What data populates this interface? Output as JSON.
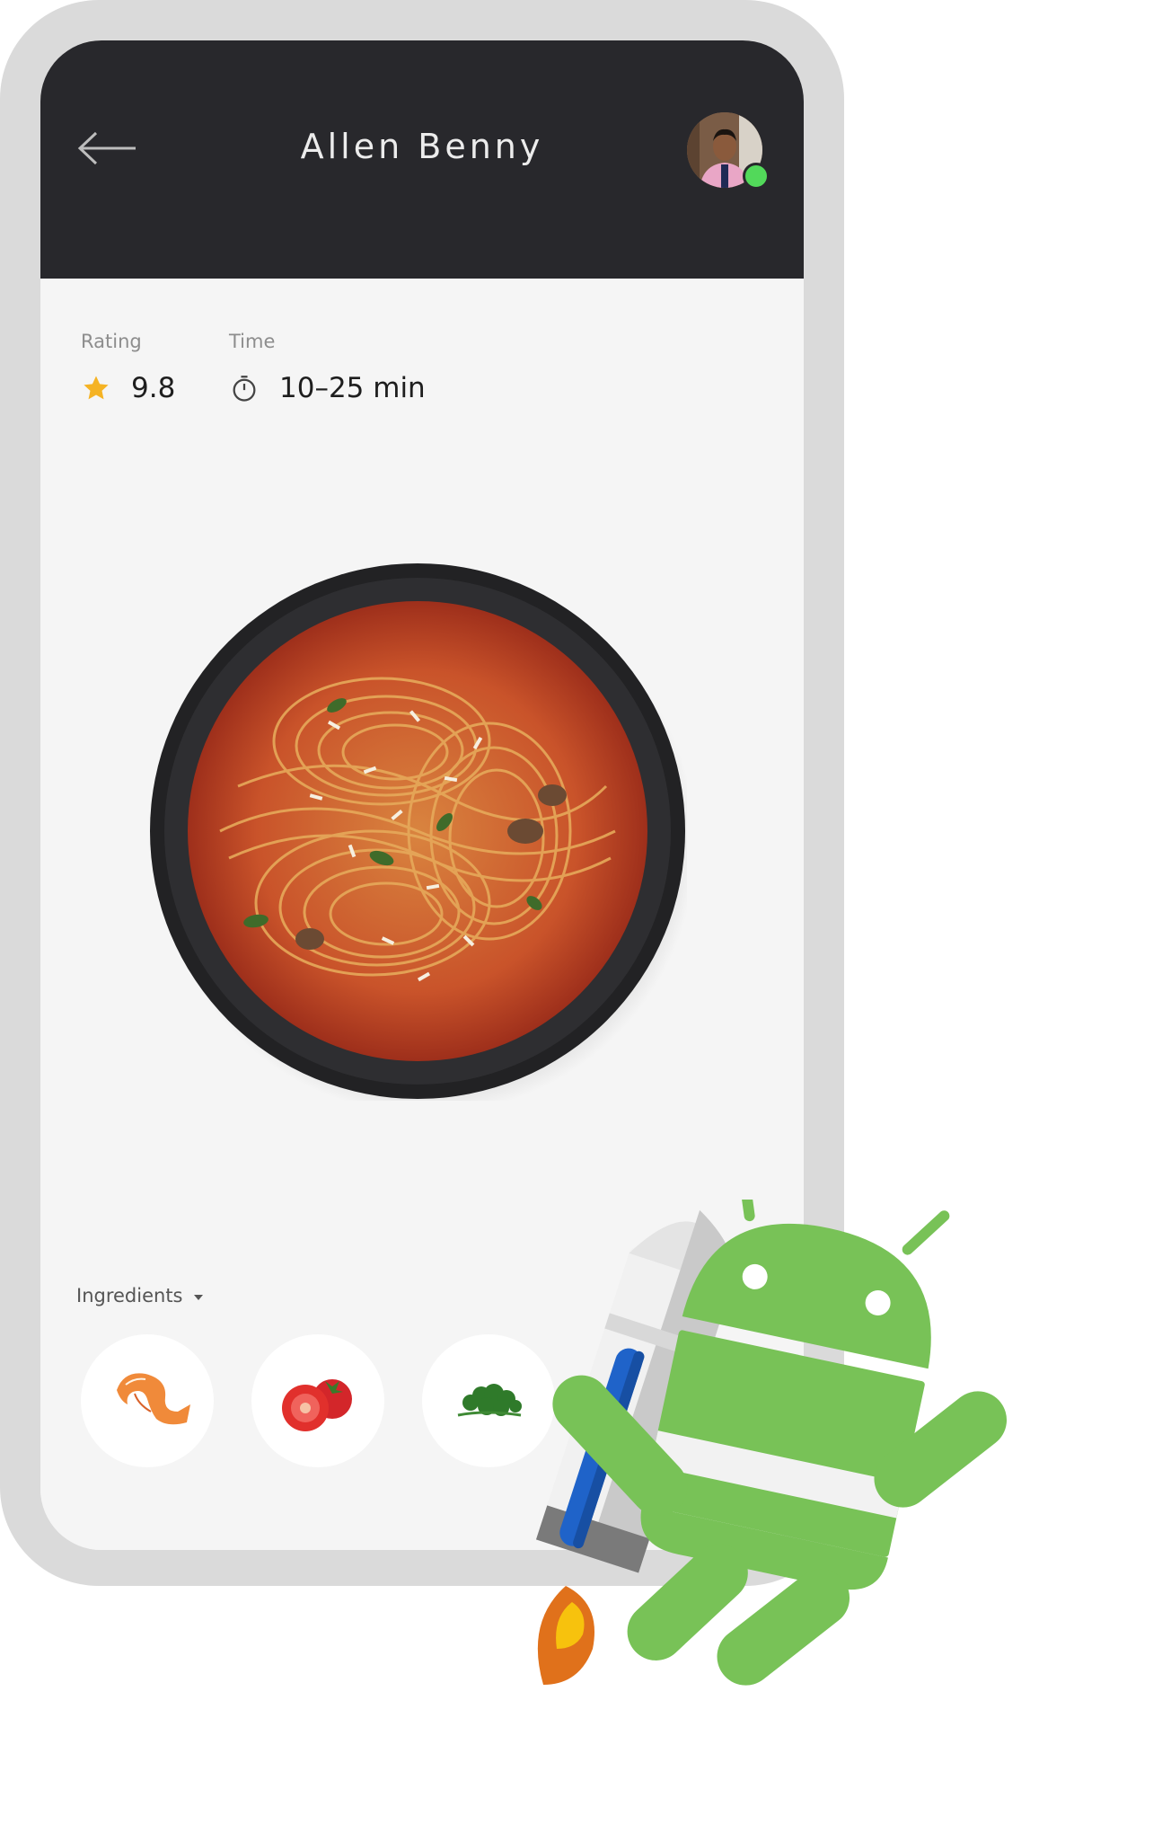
{
  "header": {
    "title": "Allen Benny"
  },
  "stats": {
    "rating": {
      "label": "Rating",
      "value": "9.8"
    },
    "time": {
      "label": "Time",
      "value": "10–25 min"
    }
  },
  "ingredients": {
    "label": "Ingredients",
    "items": [
      "shrimp-icon",
      "tomato-icon",
      "parsley-icon"
    ]
  },
  "colors": {
    "header_bg": "#28282c",
    "screen_bg": "#f5f5f5",
    "star": "#f5b324",
    "online": "#52d95a",
    "android_green": "#78c257"
  }
}
